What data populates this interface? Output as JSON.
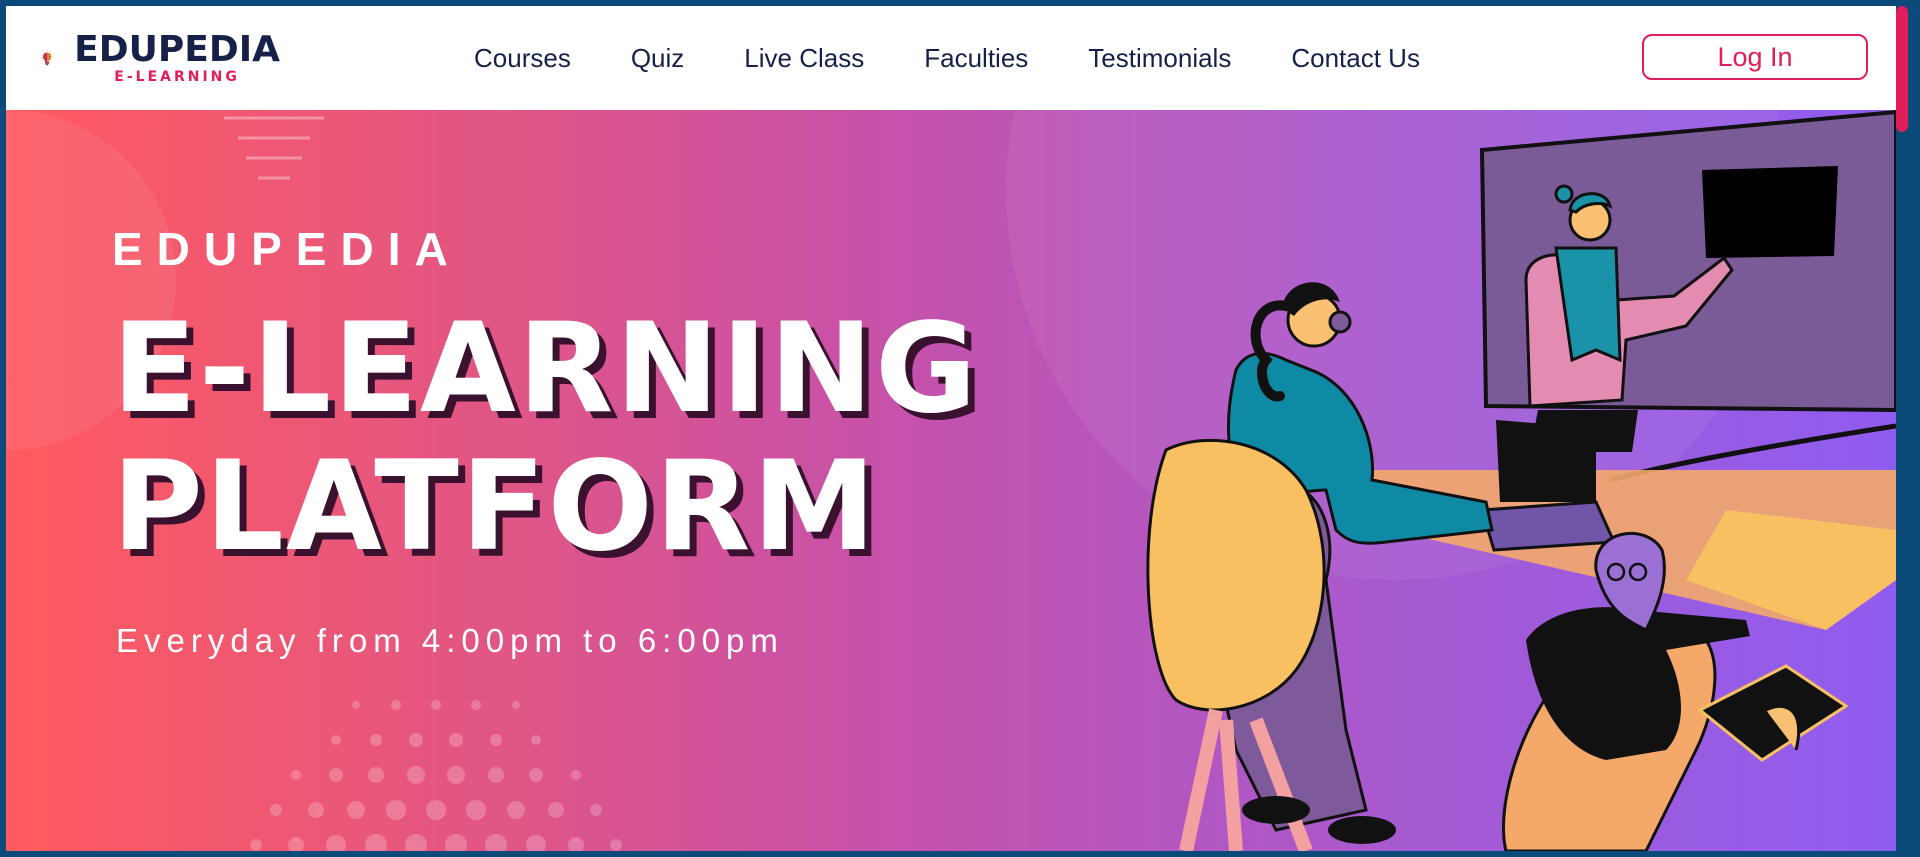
{
  "brand": {
    "name": "EDUPEDIA",
    "tagline": "E-LEARNING",
    "logo_icon": "brain-lightbulb-icon"
  },
  "nav": {
    "items": [
      {
        "label": "Courses"
      },
      {
        "label": "Quiz"
      },
      {
        "label": "Live Class"
      },
      {
        "label": "Faculties"
      },
      {
        "label": "Testimonials"
      },
      {
        "label": "Contact Us"
      }
    ],
    "login_label": "Log In"
  },
  "hero": {
    "kicker": "EDUPEDIA",
    "title_line1": "E-LEARNING",
    "title_line2": "PLATFORM",
    "subtitle": "Everyday from 4:00pm to 6:00pm",
    "illustration": "online-class-illustration"
  },
  "colors": {
    "accent": "#e11d5a",
    "navy": "#16214a",
    "gradient_start": "#ff5a5f",
    "gradient_end": "#8f5cf0"
  }
}
